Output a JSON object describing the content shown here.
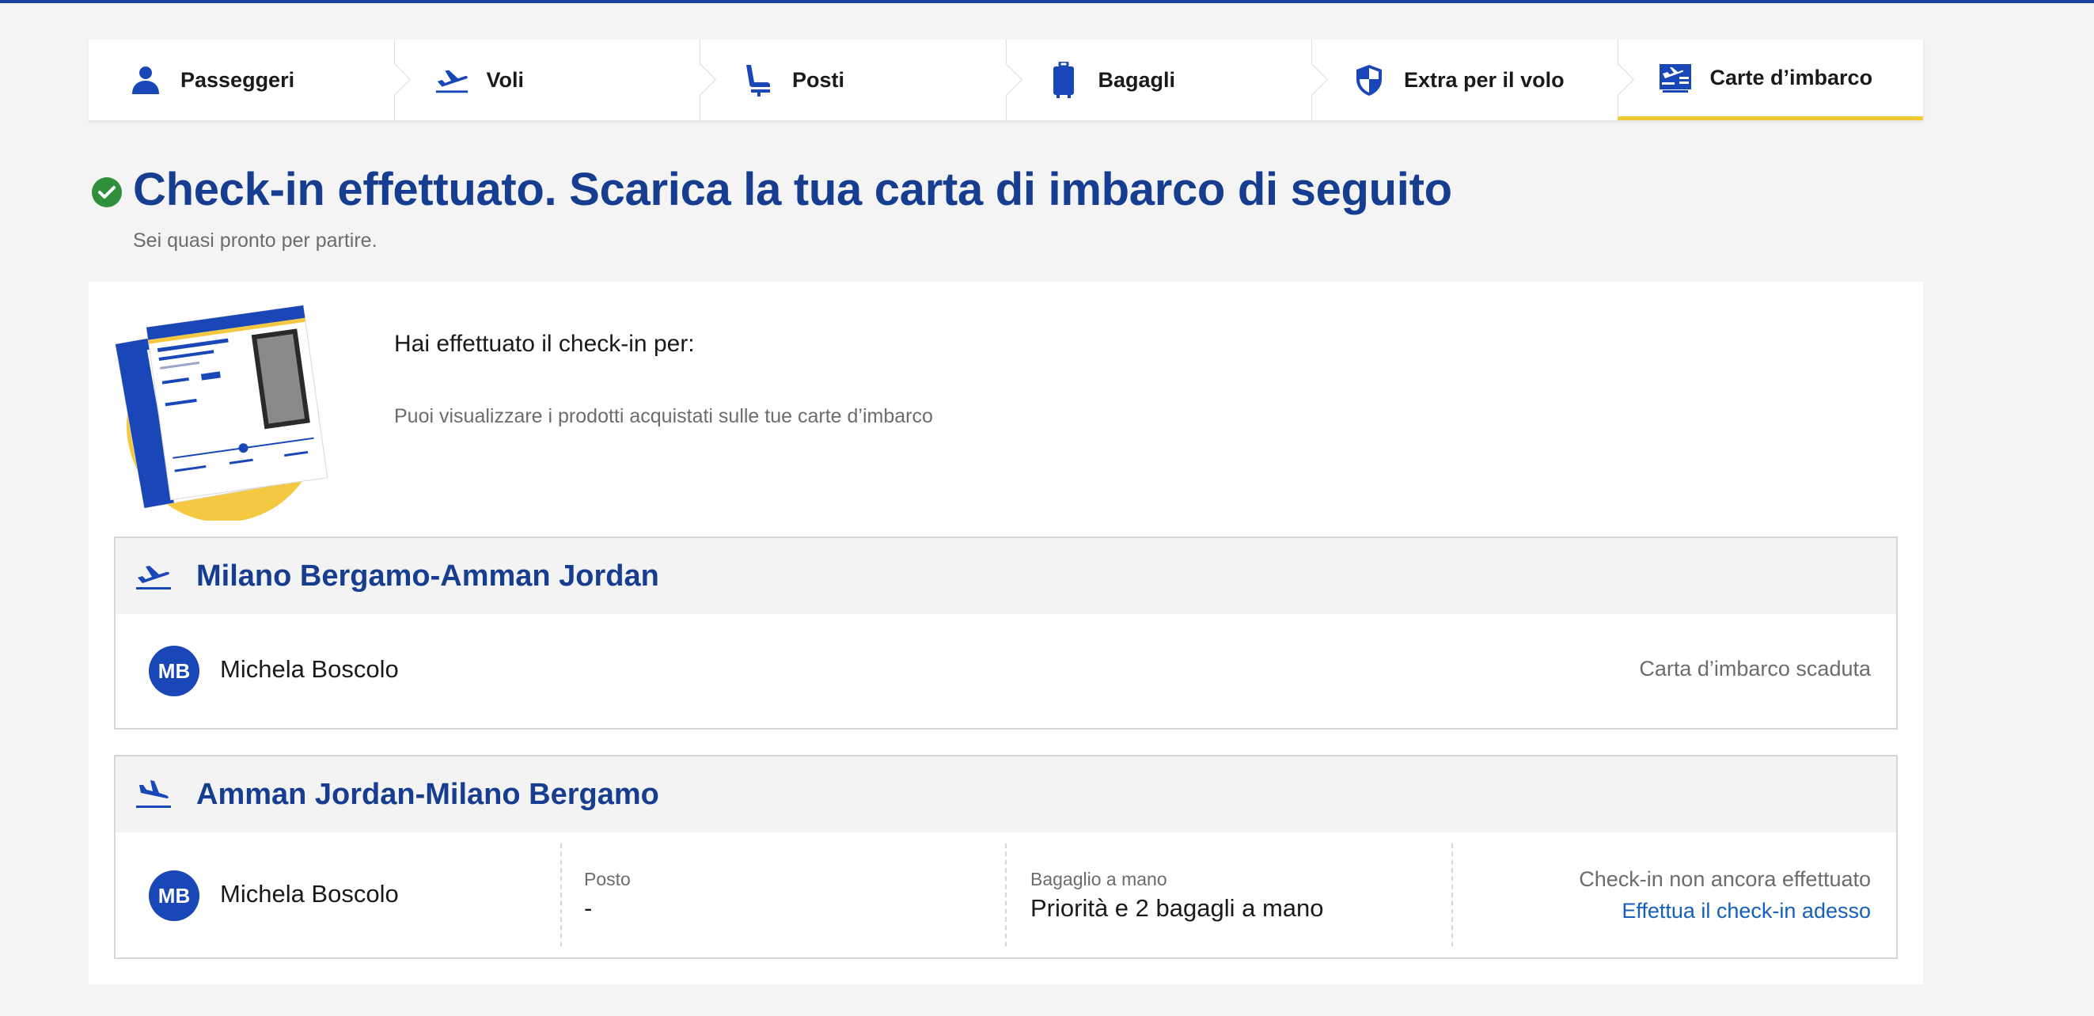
{
  "steps": [
    {
      "label": "Passeggeri",
      "icon": "person-icon"
    },
    {
      "label": "Voli",
      "icon": "plane-takeoff-icon"
    },
    {
      "label": "Posti",
      "icon": "seat-icon"
    },
    {
      "label": "Bagagli",
      "icon": "suitcase-icon"
    },
    {
      "label": "Extra per il volo",
      "icon": "shield-icon"
    },
    {
      "label": "Carte d’imbarco",
      "icon": "boarding-pass-icon",
      "active": true
    }
  ],
  "heading": {
    "title": "Check-in effettuato. Scarica la tua carta di imbarco di seguito",
    "subtitle": "Sei quasi pronto per partire."
  },
  "intro": {
    "line1": "Hai effettuato il check-in per:",
    "line2": "Puoi visualizzare i prodotti acquistati sulle tue carte d’imbarco"
  },
  "flights": [
    {
      "route": "Milano Bergamo-Amman Jordan",
      "icon": "plane-takeoff-icon",
      "passenger": {
        "initials": "MB",
        "name": "Michela Boscolo"
      },
      "status": "Carta d’imbarco scaduta"
    },
    {
      "route": "Amman Jordan-Milano Bergamo",
      "icon": "plane-landing-icon",
      "passenger": {
        "initials": "MB",
        "name": "Michela Boscolo"
      },
      "seat_label": "Posto",
      "seat_value": "-",
      "bag_label": "Bagaglio a mano",
      "bag_value": "Priorità e 2 bagagli a mano",
      "status": "Check-in non ancora effettuato",
      "action": "Effettua il check-in adesso"
    }
  ],
  "colors": {
    "brand_blue": "#163d8f",
    "accent_yellow": "#f1c933",
    "success_green": "#2f8f3a",
    "link_blue": "#1560bd"
  }
}
